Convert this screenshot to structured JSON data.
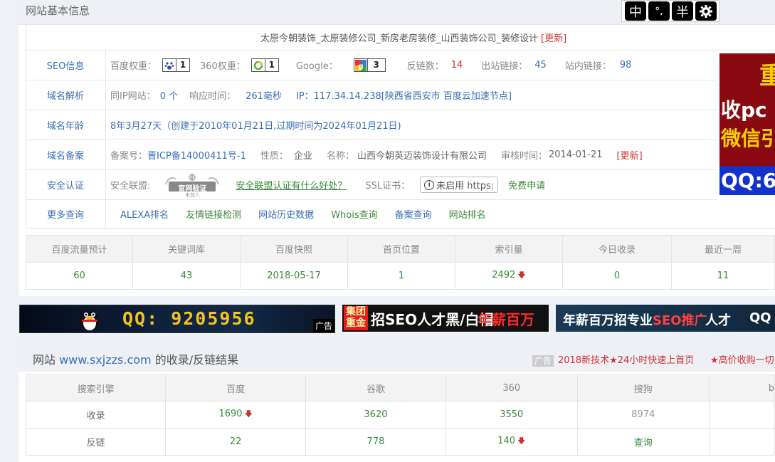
{
  "panel1": {
    "title": "网站基本信息",
    "site_title": "太原今朝装饰_太原装修公司_新房老房装修_山西装饰公司_装修设计",
    "update_label": "[更新]"
  },
  "seo": {
    "label": "SEO信息",
    "baidu_label": "百度权重：",
    "baidu_value": "1",
    "q360_label": "360权重：",
    "q360_value": "1",
    "google_label": "Google：",
    "google_value": "3",
    "backlinks_label": "反链数：",
    "backlinks_value": "14",
    "outlinks_label": "出站链接：",
    "outlinks_value": "45",
    "inlinks_label": "站内链接：",
    "inlinks_value": "98"
  },
  "domain": {
    "label": "域名解析",
    "sameip_label": "同IP网站：",
    "sameip_value": "0 个",
    "resp_label": "响应时间：",
    "resp_value": "261毫秒",
    "ip_label": "IP：",
    "ip_value": "117.34.14.238[陕西省西安市 百度云加速节点]"
  },
  "age": {
    "label": "域名年龄",
    "value": "8年3月27天（创建于2010年01月21日,过期时间为2024年01月21日)"
  },
  "beian": {
    "label": "域名备案",
    "no_label": "备案号：",
    "no_value": "晋ICP备14000411号-1",
    "nature_label": "性质：",
    "nature_value": "企业",
    "name_label": "名称：",
    "name_value": "山西今朝英迈装饰设计有限公司",
    "audit_label": "审核时间：",
    "audit_value": "2014-01-21",
    "update_label": "[更新]"
  },
  "security": {
    "label": "安全认证",
    "alliance_label": "安全联盟:",
    "seal_top": "安全联盟",
    "seal_main": "官网验证",
    "seal_bottom": "未加入",
    "alliance_link": "安全联盟认证有什么好处？",
    "ssl_label": "SSL证书：",
    "ssl_status": "未启用 https:",
    "ssl_apply": "免费申请"
  },
  "more": {
    "label": "更多查询",
    "links": [
      "ALEXA排名",
      "友情链接检测",
      "网站历史数据",
      "Whois查询",
      "备案查询",
      "网站排名"
    ]
  },
  "stats": {
    "headers": [
      "百度流量预计",
      "关键词库",
      "百度快照",
      "首页位置",
      "索引量",
      "今日收录",
      "最近一周"
    ],
    "values": [
      "60",
      "43",
      "2018-05-17",
      "1",
      "2492",
      "0",
      "11"
    ]
  },
  "right_ad": {
    "line1": "重",
    "line2": "收pc",
    "line3": "微信引",
    "line4": "QQ:6"
  },
  "banners": {
    "qq_text": "QQ: 9205956",
    "ad_tag": "广告",
    "group_tag": "集团重金",
    "seo_text": "招SEO人才黑/白帽",
    "seo_salary": "年薪百万",
    "b3_text1": "年薪百万招专业",
    "b3_text2": "SEO推广",
    "b3_text3": "人才",
    "b3_qq": "QQ"
  },
  "panel2": {
    "title_prefix": "网站 ",
    "domain": "www.sxjzzs.com",
    "title_suffix": " 的收录/反链结果",
    "ad_tag": "广告",
    "ad_text1": "2018新技术★24小时快速上首页",
    "ad_text2": "★高价收购一切",
    "headers": [
      "搜索引擎",
      "百度",
      "谷歌",
      "360",
      "搜狗",
      "b"
    ],
    "row1": [
      "收录",
      "1690",
      "3620",
      "3550",
      "8974",
      ""
    ],
    "row2": [
      "反链",
      "22",
      "778",
      "140",
      "查询",
      ""
    ]
  },
  "ime": {
    "k1": "中",
    "k2": "°,",
    "k3": "半"
  }
}
